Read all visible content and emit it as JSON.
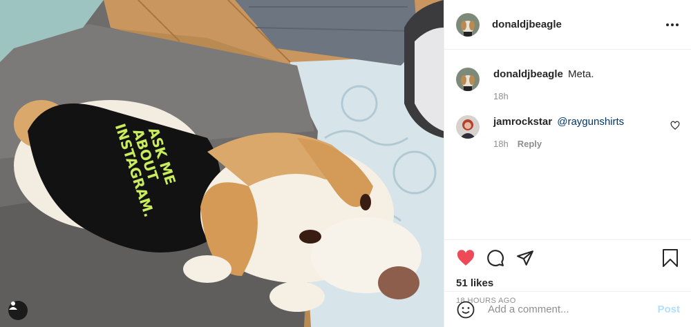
{
  "post": {
    "author": "donaldjbeagle",
    "shirt_text": [
      "ASK ME",
      "ABOUT",
      "INSTAGRAM."
    ]
  },
  "comments": [
    {
      "username": "donaldjbeagle",
      "text": "Meta.",
      "time": "18h"
    },
    {
      "username": "jamrockstar",
      "mention": "@raygunshirts",
      "time": "18h",
      "reply_label": "Reply"
    }
  ],
  "likes_label": "51 likes",
  "timestamp": "18 HOURS AGO",
  "add_comment": {
    "placeholder": "Add a comment...",
    "post_label": "Post"
  },
  "icons": {
    "tag": "user-tag-icon",
    "more": "more-options-icon",
    "like": "heart-filled-icon",
    "comment": "comment-bubble-icon",
    "share": "paper-plane-icon",
    "save": "bookmark-icon",
    "emoji": "smiley-icon",
    "comment_like": "heart-outline-icon"
  },
  "colors": {
    "like": "#ed4956",
    "mention": "#00376b",
    "post_disabled": "#b2dffc",
    "muted": "#8e8e8e"
  }
}
